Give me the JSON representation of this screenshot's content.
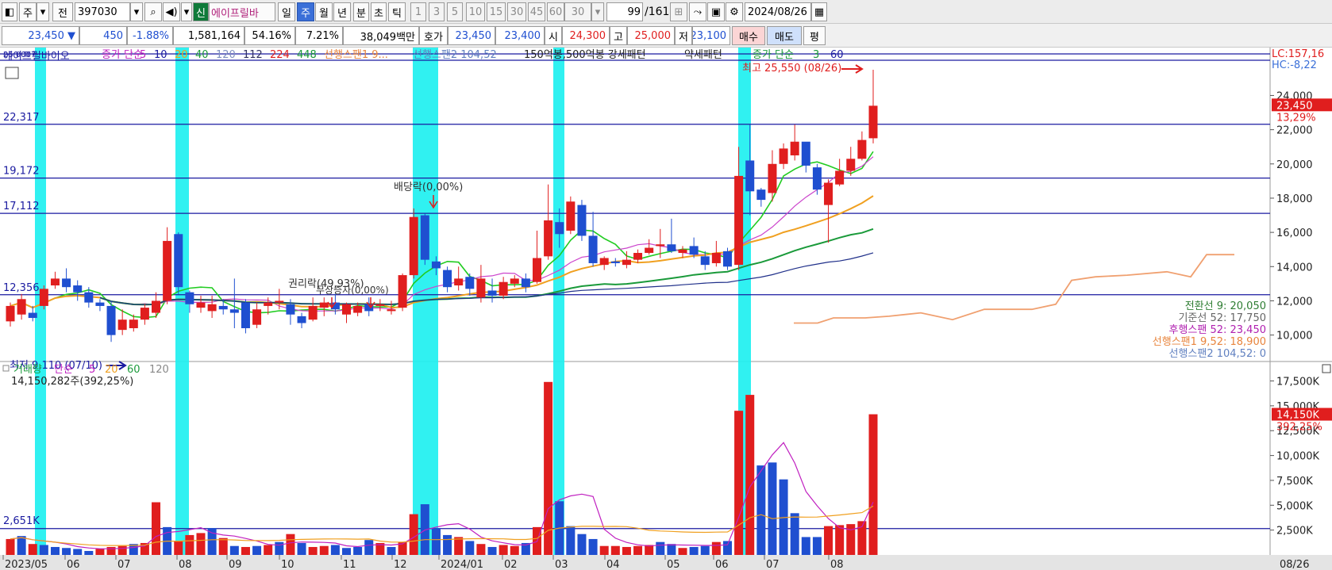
{
  "toolbar": {
    "type_label": "주",
    "prev_label": "전",
    "code": "397030",
    "new_badge": "신",
    "stock_name": "에이프릴바",
    "periods": [
      "일",
      "주",
      "월",
      "년",
      "분",
      "초",
      "틱"
    ],
    "active_period": "주",
    "intervals": [
      "1",
      "3",
      "5",
      "10",
      "15",
      "30",
      "45",
      "60"
    ],
    "interval_value": "30",
    "count_value": "99",
    "count_total": "/161",
    "date": "2024/08/26"
  },
  "quote": {
    "price": "23,450",
    "arrow": "▼",
    "change": "450",
    "change_pct": "-1.88%",
    "volume": "1,581,164",
    "pct1": "54.16%",
    "pct2": "7.21%",
    "amount": "38,049백만",
    "hoga_label": "호가",
    "ask": "23,450",
    "bid": "23,400",
    "open_label": "시",
    "open": "24,300",
    "high_label": "고",
    "high": "25,000",
    "low_label": "저",
    "low": "23,100",
    "buy_label": "매수",
    "sell_label": "매도",
    "flat_label": "평"
  },
  "legend": {
    "small_code": "25 0007",
    "stock": "에이프릴바이오",
    "close_ma": "종가 단순",
    "ma": [
      "5",
      "10",
      "20",
      "40",
      "120",
      "112",
      "224",
      "448"
    ],
    "span1": "선행스팬1 9...",
    "span2": "선행스팬2 104,52",
    "pattern": "150억봉,500억봉 강세패턴",
    "weak": "약세패턴",
    "close_ma2": "종가 단순",
    "ma2": [
      "3",
      "60"
    ]
  },
  "vol_legend": {
    "title": "거래량",
    "simple": "단순",
    "ma": [
      "5",
      "20",
      "60",
      "120"
    ],
    "shares": "14,150,282주(392,25%)"
  },
  "annotations": {
    "max": "최고 25,550 (08/26)",
    "min": "최저 9,110 (07/10)",
    "dividend": "배당락(0,00%)",
    "rights": "권리락(49,93%)",
    "bonus": "무상증자(0,00%)"
  },
  "right_info": {
    "lc": "LC:157,16",
    "hc": "HC:-8,22",
    "cur": "23,450",
    "cur_pct": "13,29%",
    "vol_cur": "14,150K",
    "vol_pct": "392,25%"
  },
  "ichimoku": [
    {
      "label": "전환선 9: 20,050",
      "color": "#2e7d32"
    },
    {
      "label": "기준선 52: 17,750",
      "color": "#666666"
    },
    {
      "label": "후행스팬 52: 23,450",
      "color": "#b020b0"
    },
    {
      "label": "선행스팬1 9,52: 18,900",
      "color": "#e8843c"
    },
    {
      "label": "선행스팬2 104,52: 0",
      "color": "#6080c0"
    }
  ],
  "colors": {
    "up": "#e01e1e",
    "down": "#1f4fd0",
    "highlight": "#1ef0f0",
    "hline": "#1a1aa0",
    "ma5": "#22cc22",
    "ma10": "#cc44cc",
    "ma20": "#f0a020",
    "ma40": "#1a9a3a",
    "ma60": "#20308a",
    "span": "#f0a070"
  },
  "chart_data": [
    {
      "type": "candlestick",
      "y_axis_ticks": [
        "24,000",
        "22,000",
        "20,000",
        "18,000",
        "16,000",
        "14,000",
        "12,000",
        "10,000"
      ],
      "y_range": [
        8500,
        26800
      ],
      "x_ticks": [
        "2023/05",
        "06",
        "07",
        "08",
        "09",
        "10",
        "11",
        "12",
        "2024/01",
        "02",
        "03",
        "04",
        "05",
        "06",
        "07",
        "08"
      ],
      "hlines": [
        {
          "label": "22,317",
          "value": 22317
        },
        {
          "label": "19,172",
          "value": 19172
        },
        {
          "label": "17,112",
          "value": 17112
        },
        {
          "label": "12,356",
          "value": 12356
        }
      ],
      "last_date": "08/26",
      "candles": [
        [
          10800,
          11700,
          10500,
          11900
        ],
        [
          11200,
          12100,
          10900,
          12400
        ],
        [
          11300,
          11000,
          10800,
          11700
        ],
        [
          11700,
          12700,
          11500,
          12900
        ],
        [
          12900,
          13300,
          12700,
          13700
        ],
        [
          13300,
          12800,
          12500,
          13900
        ],
        [
          12900,
          12500,
          12000,
          13200
        ],
        [
          12500,
          11900,
          11600,
          12800
        ],
        [
          11900,
          11700,
          11400,
          12100
        ],
        [
          11700,
          10000,
          9600,
          12000
        ],
        [
          10300,
          10900,
          10000,
          11500
        ],
        [
          10400,
          10900,
          10200,
          11200
        ],
        [
          10900,
          11600,
          10600,
          11800
        ],
        [
          11300,
          12000,
          11000,
          12500
        ],
        [
          12000,
          15500,
          11800,
          16300
        ],
        [
          15900,
          12800,
          12400,
          16000
        ],
        [
          12500,
          11800,
          11300,
          12600
        ],
        [
          11600,
          11900,
          11300,
          12300
        ],
        [
          11400,
          11800,
          11000,
          12300
        ],
        [
          11700,
          11500,
          11200,
          12100
        ],
        [
          11500,
          11300,
          10400,
          13300
        ],
        [
          11900,
          10400,
          10100,
          12100
        ],
        [
          10600,
          11500,
          10400,
          11900
        ],
        [
          11700,
          11900,
          11200,
          12200
        ],
        [
          11900,
          12000,
          11500,
          12700
        ],
        [
          11800,
          11200,
          10600,
          12100
        ],
        [
          11100,
          10700,
          10400,
          11300
        ],
        [
          10900,
          11700,
          10800,
          12200
        ],
        [
          11600,
          11900,
          11100,
          12200
        ],
        [
          11900,
          11500,
          11200,
          12400
        ],
        [
          11200,
          11800,
          10700,
          11900
        ],
        [
          11300,
          11700,
          11100,
          11900
        ],
        [
          11800,
          11400,
          11100,
          12200
        ],
        [
          11700,
          11800,
          11400,
          12100
        ],
        [
          11400,
          11500,
          11200,
          12000
        ],
        [
          11600,
          13500,
          11400,
          13600
        ],
        [
          13500,
          16900,
          13300,
          17400
        ],
        [
          17000,
          14400,
          14100,
          17100
        ],
        [
          14300,
          13900,
          13500,
          14600
        ],
        [
          13800,
          12800,
          12500,
          14000
        ],
        [
          12900,
          13300,
          12600,
          14000
        ],
        [
          13400,
          12700,
          12300,
          13600
        ],
        [
          12200,
          13300,
          11900,
          14100
        ],
        [
          12600,
          12300,
          11900,
          13300
        ],
        [
          12300,
          13100,
          12100,
          13400
        ],
        [
          13000,
          13300,
          12800,
          13500
        ],
        [
          13300,
          12800,
          12500,
          13600
        ],
        [
          13100,
          14500,
          13000,
          16100
        ],
        [
          14600,
          16700,
          14400,
          18800
        ],
        [
          16600,
          15900,
          15100,
          17400
        ],
        [
          16100,
          17800,
          15900,
          18100
        ],
        [
          17600,
          15800,
          15500,
          17900
        ],
        [
          15800,
          14200,
          14000,
          17200
        ],
        [
          14100,
          14500,
          13800,
          14600
        ],
        [
          14300,
          14200,
          14000,
          14500
        ],
        [
          14100,
          14400,
          13900,
          14900
        ],
        [
          14400,
          14800,
          14200,
          15000
        ],
        [
          14800,
          15100,
          14700,
          15600
        ],
        [
          15200,
          15300,
          14500,
          16200
        ],
        [
          15300,
          14900,
          14800,
          16800
        ],
        [
          14800,
          15000,
          14500,
          15200
        ],
        [
          15200,
          14700,
          14500,
          15700
        ],
        [
          14600,
          14100,
          13800,
          14900
        ],
        [
          14200,
          14800,
          14000,
          15500
        ],
        [
          14900,
          14000,
          13800,
          15100
        ],
        [
          14100,
          19300,
          13800,
          21000
        ],
        [
          20200,
          18400,
          17000,
          22300
        ],
        [
          18500,
          17900,
          17500,
          18600
        ],
        [
          18300,
          20000,
          17800,
          20800
        ],
        [
          20000,
          20900,
          19700,
          21200
        ],
        [
          20500,
          21300,
          20200,
          22300
        ],
        [
          21300,
          19900,
          19500,
          20500
        ],
        [
          19800,
          18500,
          18200,
          20000
        ],
        [
          17600,
          18900,
          15400,
          19100
        ],
        [
          18800,
          19600,
          18700,
          20300
        ],
        [
          19600,
          20300,
          19300,
          21000
        ],
        [
          20300,
          21400,
          20200,
          21900
        ],
        [
          21500,
          23400,
          21200,
          25500
        ]
      ]
    },
    {
      "type": "bar",
      "y_axis_ticks": [
        "17,500K",
        "15,000K",
        "12,500K",
        "10,000K",
        "7,500K",
        "5,000K",
        "2,500K"
      ],
      "y_range": [
        0,
        18500
      ],
      "hline": {
        "label": "2,651K",
        "value": 2651
      },
      "values": [
        1600,
        1900,
        1100,
        1000,
        800,
        700,
        600,
        400,
        600,
        800,
        900,
        1100,
        1200,
        5300,
        2800,
        1400,
        2000,
        2200,
        2700,
        1700,
        900,
        800,
        900,
        1000,
        1300,
        2100,
        1200,
        800,
        900,
        1000,
        700,
        800,
        1500,
        1200,
        800,
        1300,
        4100,
        5100,
        2700,
        2000,
        1800,
        1400,
        1100,
        800,
        1000,
        900,
        1200,
        2800,
        17400,
        5400,
        2900,
        2100,
        1600,
        900,
        900,
        800,
        900,
        1000,
        1300,
        1100,
        700,
        800,
        900,
        1300,
        1400,
        14500,
        16100,
        9000,
        9300,
        7600,
        4200,
        1800,
        1800,
        2900,
        3000,
        3100,
        3400,
        14150
      ],
      "down_flags": [
        0,
        1,
        0,
        1,
        1,
        1,
        1,
        1,
        0,
        0,
        0,
        1,
        0,
        0,
        1,
        0,
        0,
        0,
        1,
        0,
        1,
        0,
        1,
        0,
        1,
        0,
        1,
        0,
        0,
        1,
        1,
        1,
        1,
        0,
        1,
        0,
        0,
        1,
        1,
        1,
        0,
        1,
        0,
        1,
        0,
        0,
        1,
        0,
        0,
        1,
        1,
        1,
        1,
        0,
        0,
        0,
        0,
        0,
        1,
        1,
        0,
        1,
        1,
        0,
        1,
        0,
        0,
        1,
        1,
        1,
        1,
        1,
        1,
        0,
        0,
        0,
        0,
        0
      ]
    }
  ]
}
